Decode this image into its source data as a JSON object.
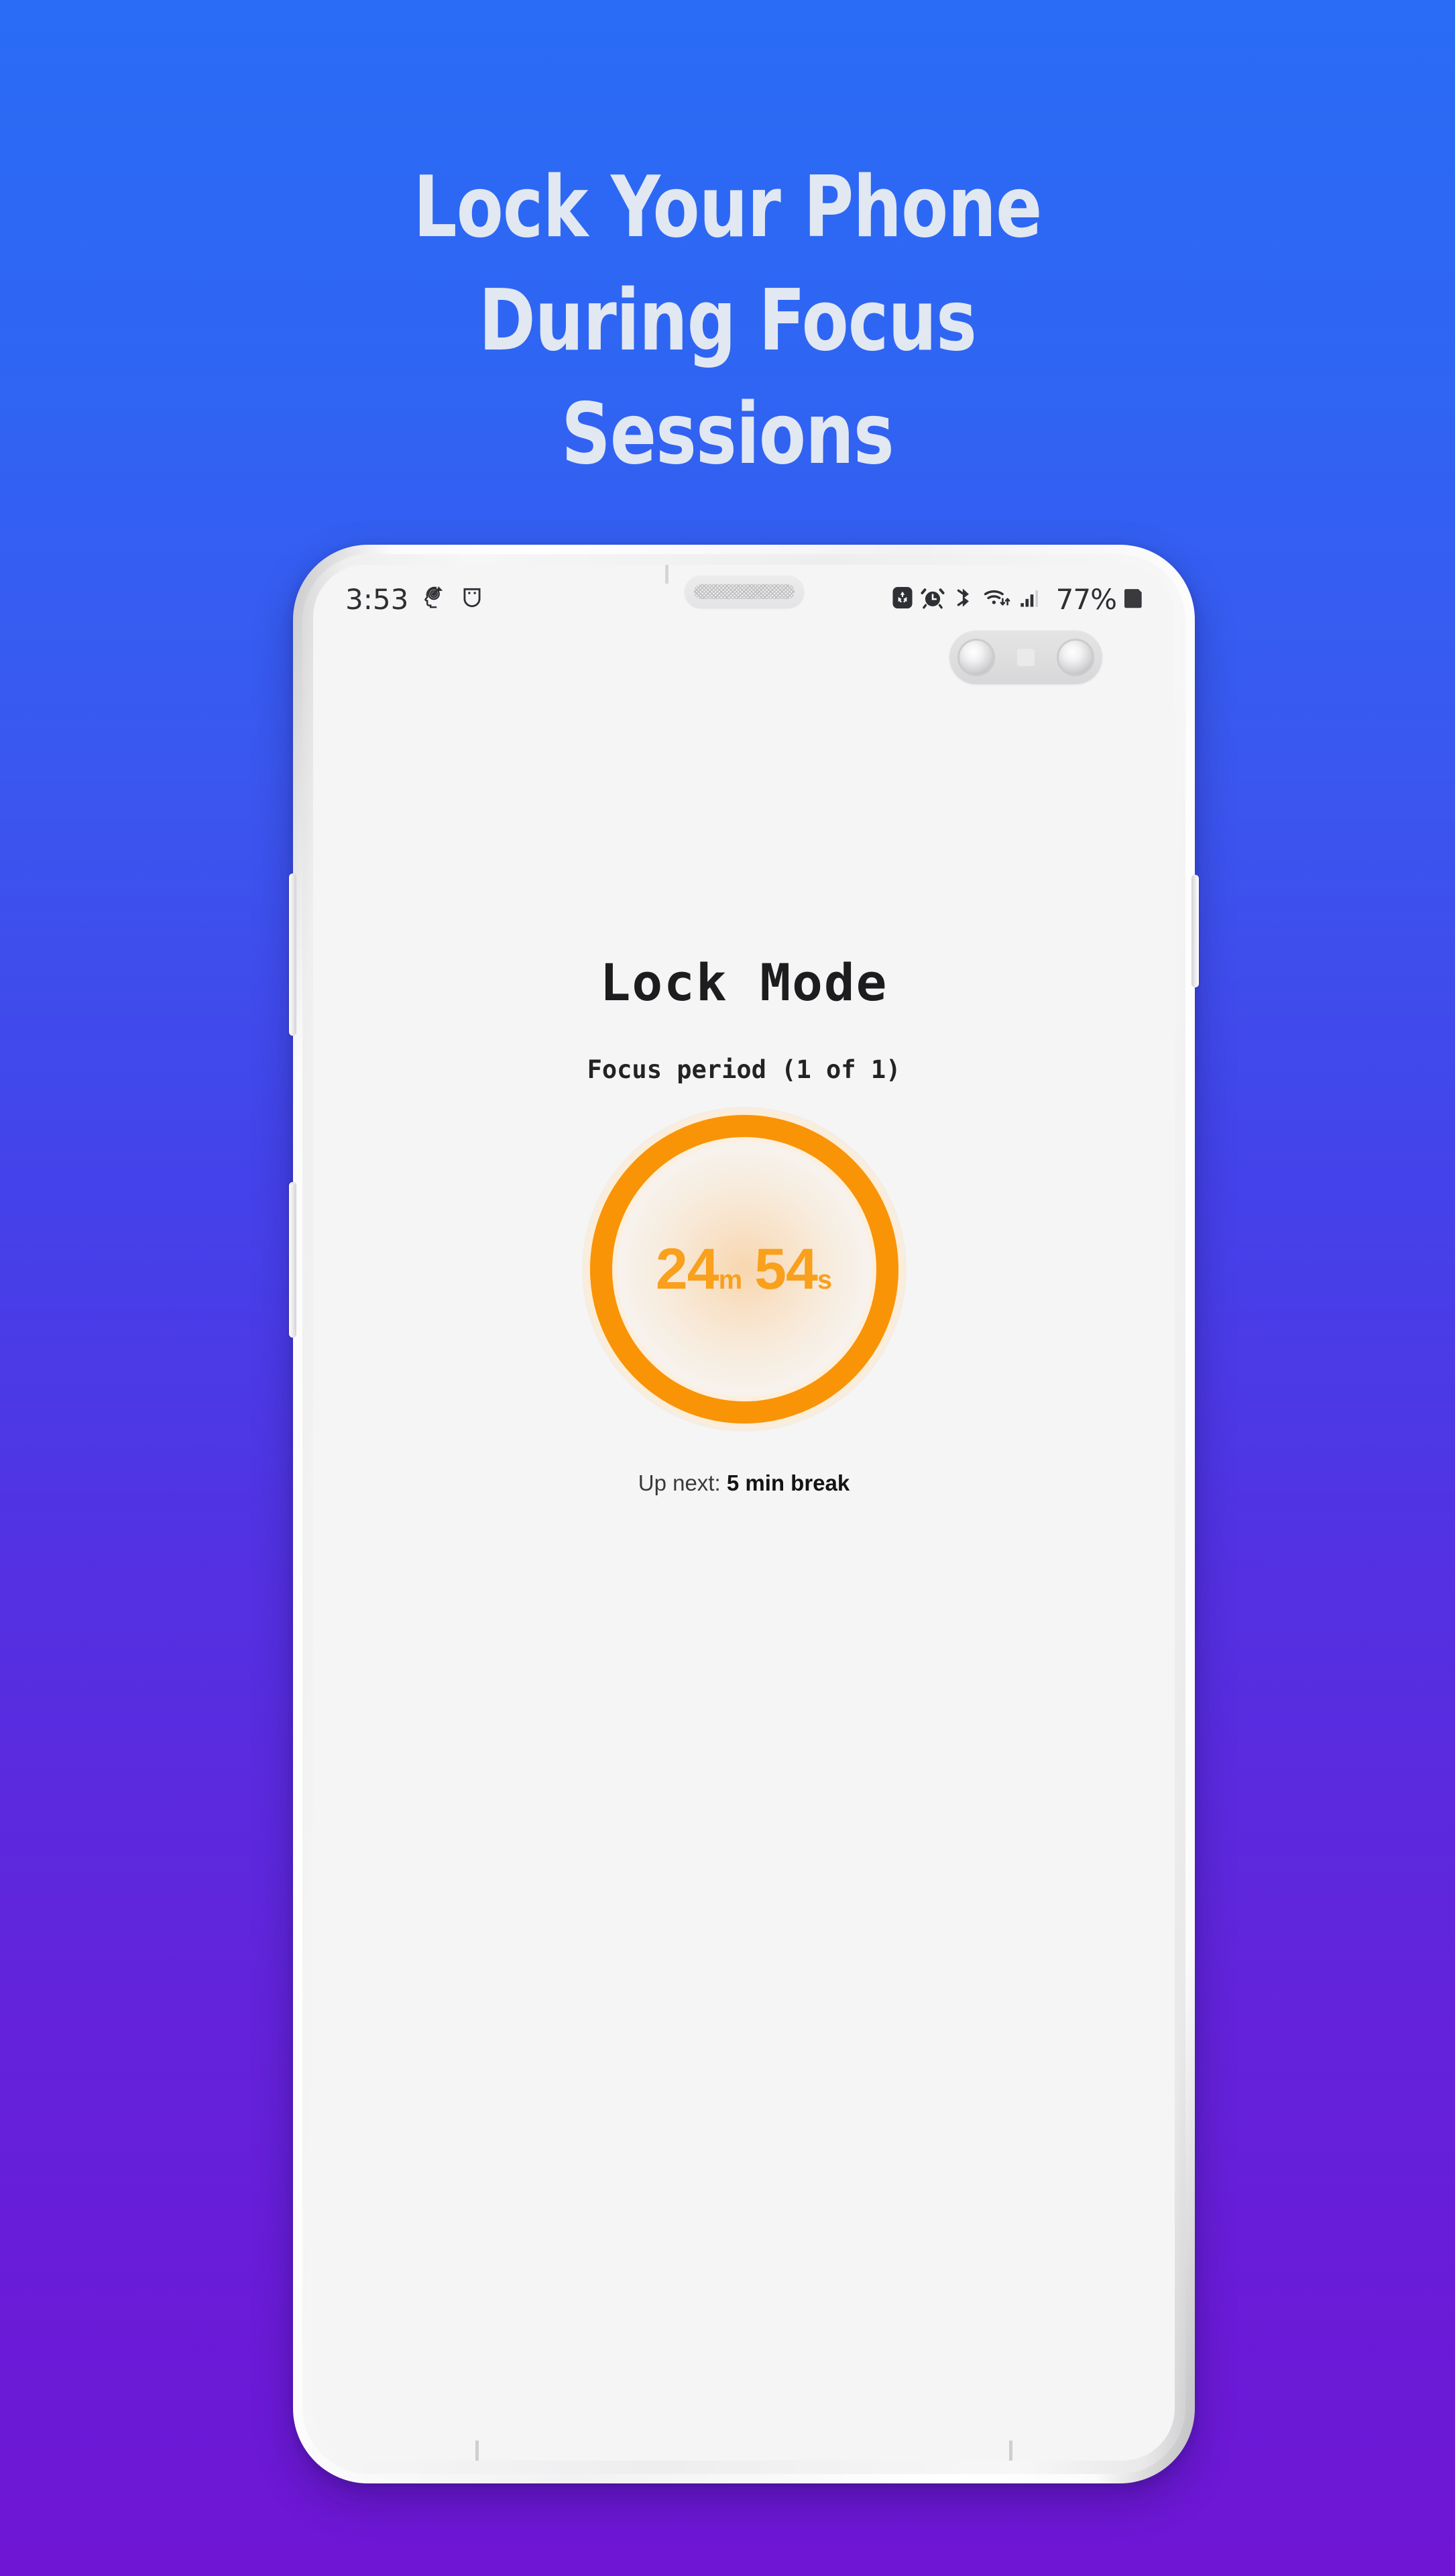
{
  "promo": {
    "headline_lines": [
      "Lock Your Phone",
      "During Focus",
      "Sessions"
    ],
    "bg_top_color": "#2a6cf5",
    "bg_bottom_color": "#6f16d4",
    "headline_color": "#e2e8f2"
  },
  "device": {
    "frame_color": "#f2f2f3",
    "screen_bg": "#f5f5f6",
    "buttons": {
      "volume_rocker": "volume-rocker",
      "bixby": "bixby-button",
      "power": "power-button"
    }
  },
  "status_bar": {
    "time": "3:53",
    "notification_icons": [
      "focus-head-icon",
      "smiley-face-icon"
    ],
    "system_icons": [
      "eco-save-icon",
      "alarm-clock-icon",
      "bluetooth-icon",
      "wifi-icon",
      "signal-bars-icon"
    ],
    "battery_percent": "77%",
    "battery_icon": "battery-icon"
  },
  "app": {
    "title": "Lock Mode",
    "subtitle": "Focus period (1 of 1)",
    "timer": {
      "minutes": "24",
      "minutes_unit": "m",
      "seconds": "54",
      "seconds_unit": "s",
      "ring_color": "#f99406",
      "text_color": "#f9a01c"
    },
    "up_next_label": "Up next:",
    "up_next_value": "5 min break"
  }
}
